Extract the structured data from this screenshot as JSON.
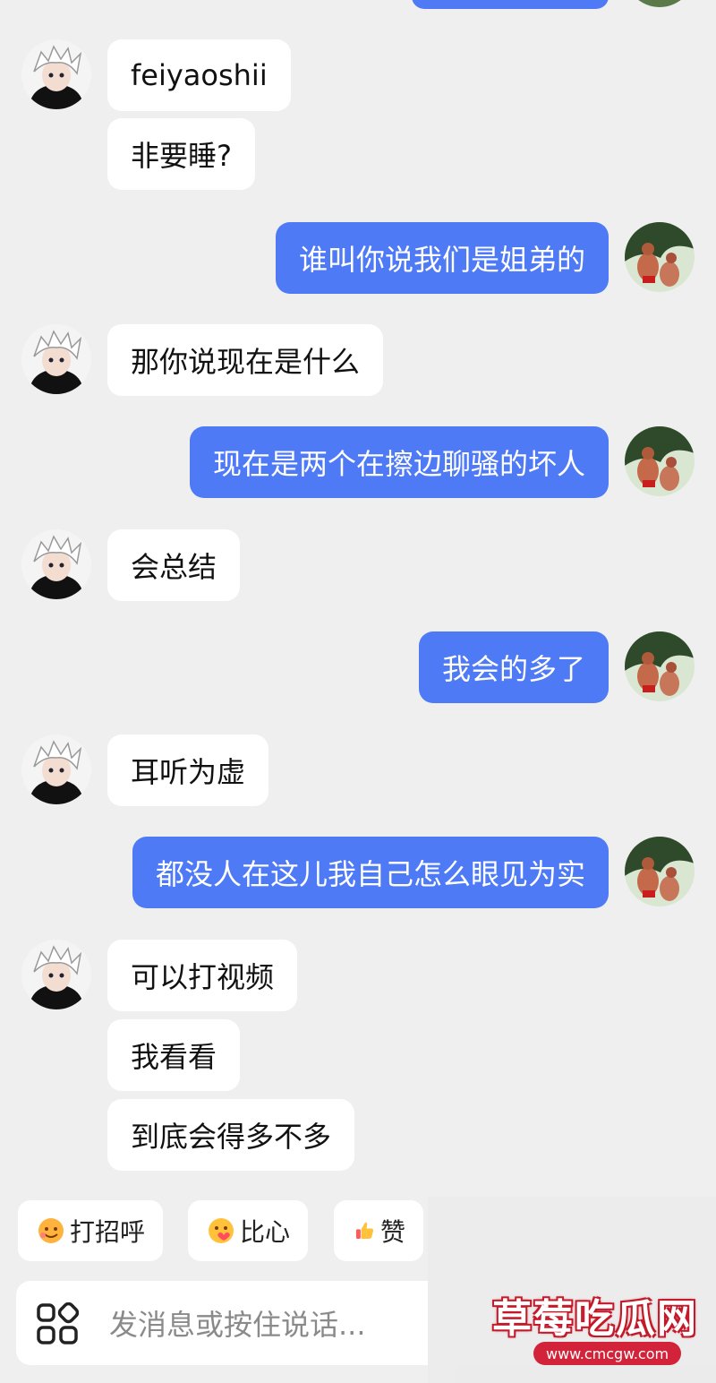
{
  "conversation": {
    "messages": [
      {
        "side": "them",
        "text": "feiyaoshii"
      },
      {
        "side": "them",
        "text": "非要睡?"
      },
      {
        "side": "me",
        "text": "谁叫你说我们是姐弟的"
      },
      {
        "side": "them",
        "text": "那你说现在是什么"
      },
      {
        "side": "me",
        "text": "现在是两个在擦边聊骚的坏人"
      },
      {
        "side": "them",
        "text": "会总结"
      },
      {
        "side": "me",
        "text": "我会的多了"
      },
      {
        "side": "them",
        "text": "耳听为虚"
      },
      {
        "side": "me",
        "text": "都没人在这儿我自己怎么眼见为实"
      },
      {
        "side": "them",
        "text": "可以打视频"
      },
      {
        "side": "them",
        "text": "我看看"
      },
      {
        "side": "them",
        "text": "到底会得多不多"
      }
    ]
  },
  "quick_replies": [
    {
      "label": "打招呼",
      "icon": "smile-wave-icon"
    },
    {
      "label": "比心",
      "icon": "heart-hands-icon"
    },
    {
      "label": "赞",
      "icon": "thumbs-up-icon"
    }
  ],
  "input": {
    "placeholder": "发消息或按住说话...",
    "apps_icon": "apps-grid-icon"
  },
  "watermark": {
    "title": "草莓吃瓜网",
    "url": "www.cmcgw.com"
  },
  "colors": {
    "background": "#efefef",
    "my_bubble": "#4e7af6",
    "their_bubble": "#ffffff"
  }
}
